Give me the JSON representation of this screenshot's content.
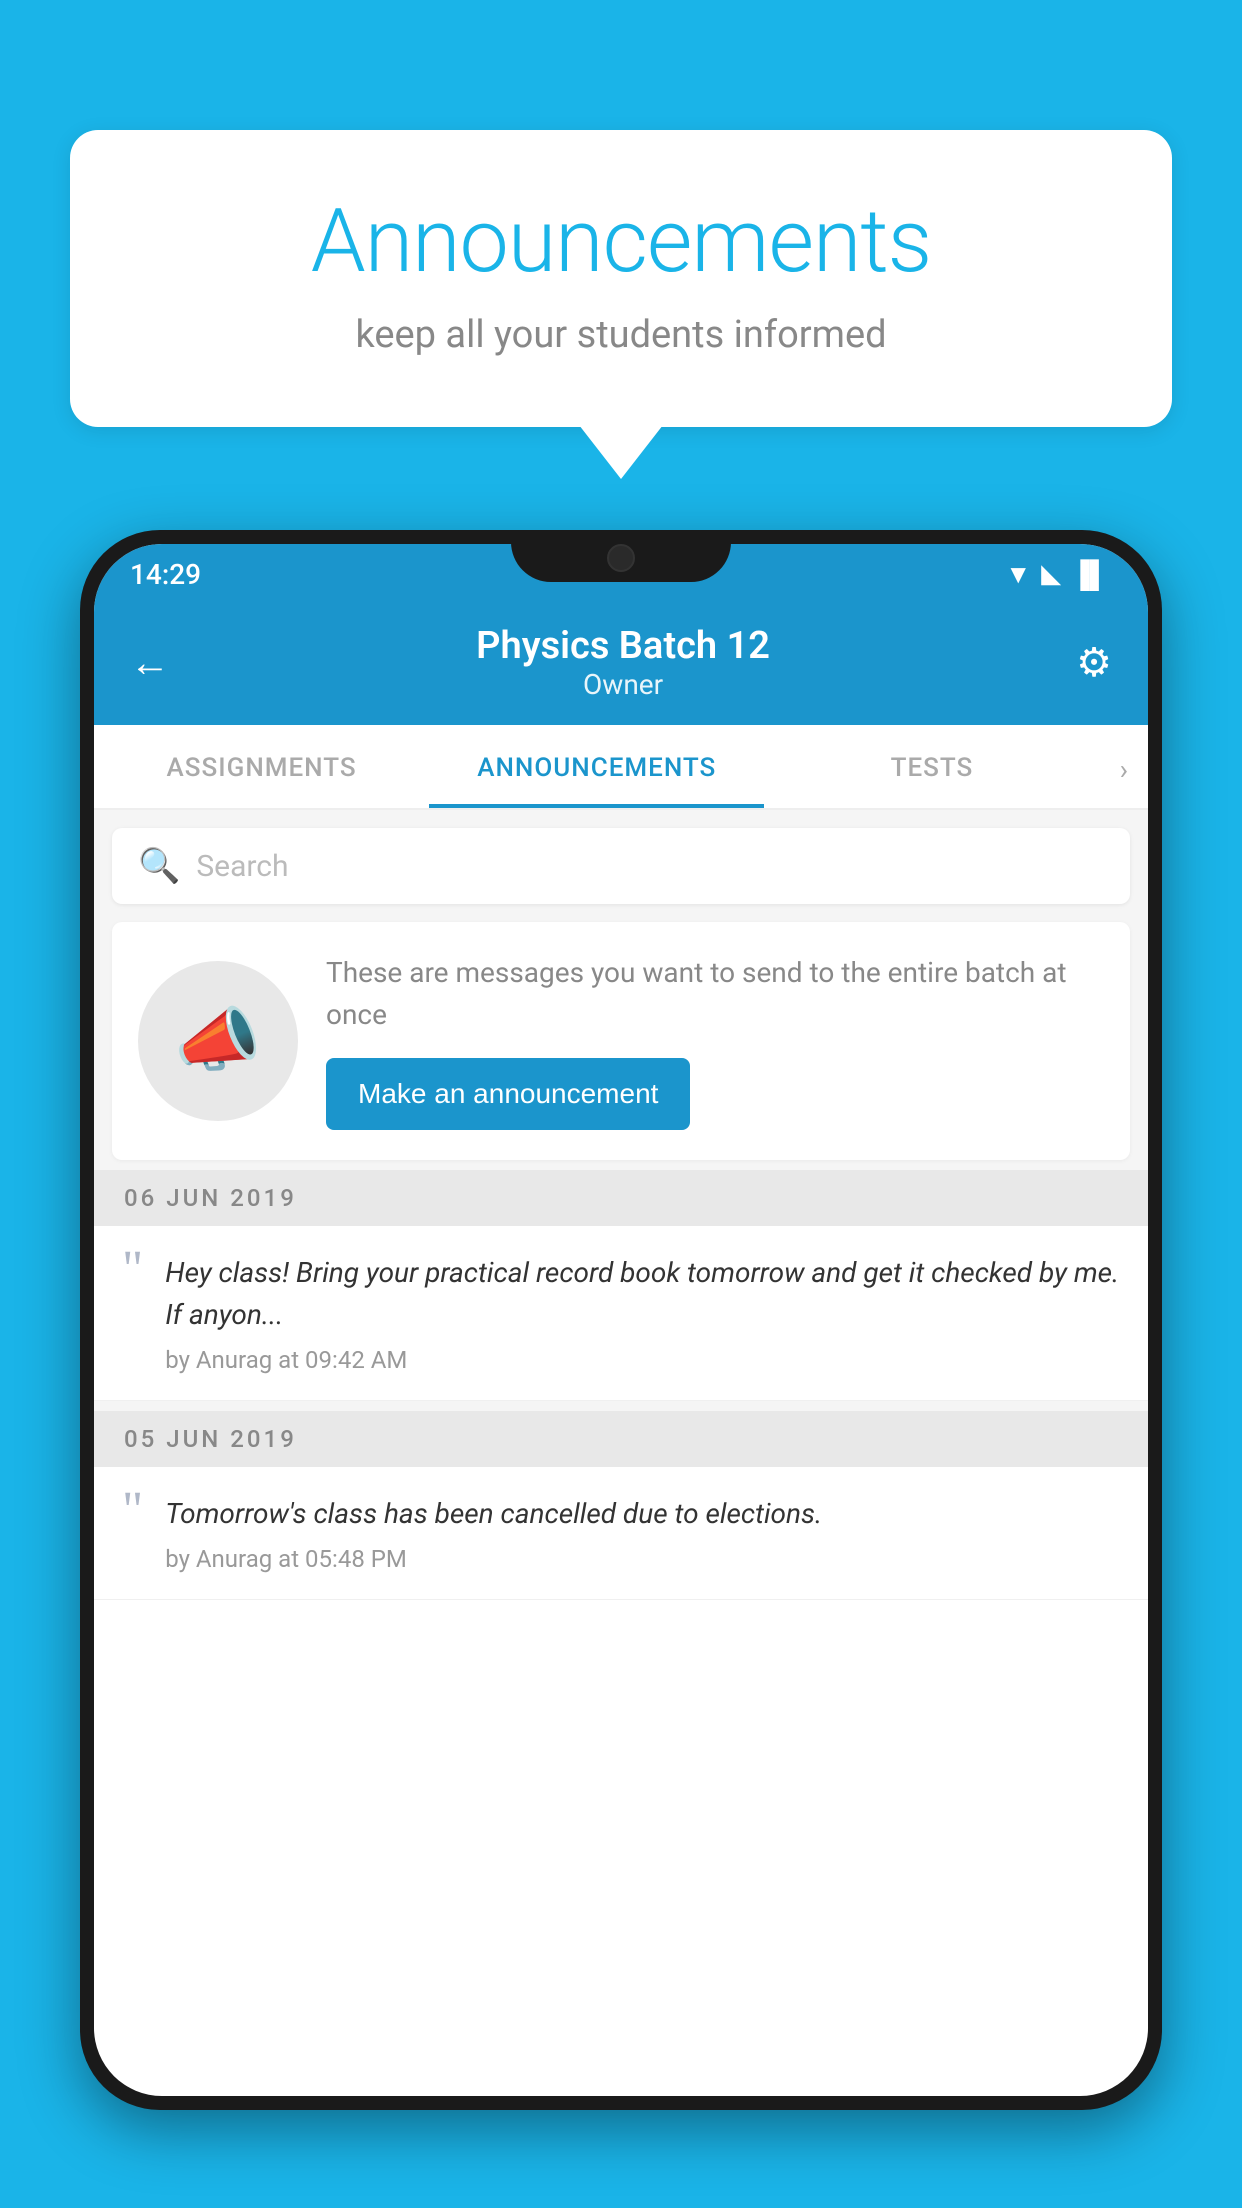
{
  "background": {
    "color": "#1ab4e8"
  },
  "speech_bubble": {
    "title": "Announcements",
    "subtitle": "keep all your students informed"
  },
  "status_bar": {
    "time": "14:29",
    "wifi": "▲",
    "signal": "▲",
    "battery": "▐"
  },
  "header": {
    "title": "Physics Batch 12",
    "subtitle": "Owner",
    "back_label": "←",
    "gear_label": "⚙"
  },
  "tabs": [
    {
      "label": "ASSIGNMENTS",
      "active": false
    },
    {
      "label": "ANNOUNCEMENTS",
      "active": true
    },
    {
      "label": "TESTS",
      "active": false
    }
  ],
  "search": {
    "placeholder": "Search"
  },
  "empty_state": {
    "description": "These are messages you want to send to the entire batch at once",
    "button_label": "Make an announcement"
  },
  "announcements": [
    {
      "date": "06  JUN  2019",
      "message": "Hey class! Bring your practical record book tomorrow and get it checked by me. If anyon...",
      "author": "by Anurag at 09:42 AM"
    },
    {
      "date": "05  JUN  2019",
      "message": "Tomorrow's class has been cancelled due to elections.",
      "author": "by Anurag at 05:48 PM"
    }
  ]
}
